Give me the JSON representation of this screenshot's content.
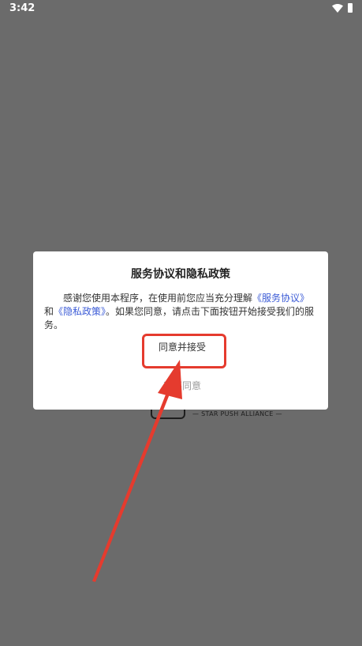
{
  "status_bar": {
    "time": "3:42",
    "wifi_icon": "wifi-icon",
    "battery_icon": "battery-icon"
  },
  "background": {
    "alliance_text": "— STAR PUSH ALLIANCE —"
  },
  "dialog": {
    "title": "服务协议和隐私政策",
    "body_prefix": "感谢您使用本程序，在使用前您应当充分理解",
    "service_agreement_link": "《服务协议》",
    "body_and": "和",
    "privacy_policy_link": "《隐私政策》",
    "body_suffix": "。如果您同意，请点击下面按钮开始接受我们的服务。",
    "accept_label": "同意并接受",
    "decline_label": "我不同意"
  },
  "annotation": {
    "color": "#e53b2e"
  }
}
